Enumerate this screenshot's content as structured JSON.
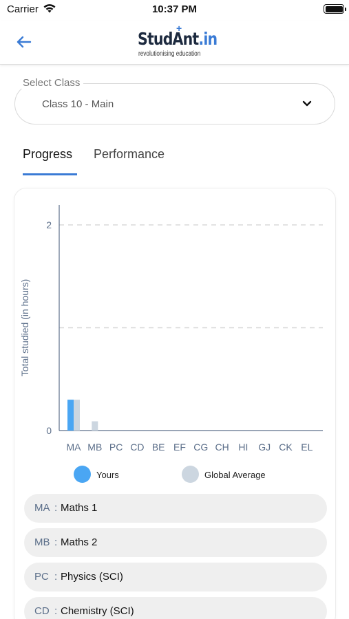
{
  "status_bar": {
    "carrier": "Carrier",
    "time": "10:37 PM",
    "wifi_icon": "wifi-icon",
    "battery_icon": "battery-icon"
  },
  "header": {
    "back_icon": "arrow-left-icon",
    "logo": {
      "main": "StudAnt",
      "tld": ".in",
      "star": "+",
      "tagline": "revolutionising education"
    }
  },
  "class_select": {
    "label": "Select Class",
    "value": "Class 10 - Main",
    "chevron_icon": "chevron-down-icon"
  },
  "tabs": [
    {
      "label": "Progress",
      "active": true
    },
    {
      "label": "Performance",
      "active": false
    }
  ],
  "colors": {
    "accent": "#3a7bd5",
    "yours": "#4aa6f3",
    "global_average": "#ccd6e0",
    "axis": "#5c6f8a",
    "pill_bg": "#efefef"
  },
  "chart_data": {
    "type": "bar",
    "title": "",
    "xlabel": "",
    "ylabel": "Total studied (in hours)",
    "ylim": [
      0,
      2
    ],
    "yticks": [
      0,
      2
    ],
    "grid": "dashed horizontal at 1 and 2",
    "legend_position": "bottom",
    "categories": [
      "MA",
      "MB",
      "PC",
      "CD",
      "BE",
      "EF",
      "CG",
      "CH",
      "HI",
      "GJ",
      "CK",
      "EL"
    ],
    "series": [
      {
        "name": "Yours",
        "color": "#4aa6f3",
        "values": [
          0.3,
          0,
          0,
          0,
          0,
          0,
          0,
          0,
          0,
          0,
          0,
          0
        ]
      },
      {
        "name": "Global Average",
        "color": "#ccd6e0",
        "values": [
          0.3,
          0.09,
          0,
          0,
          0,
          0,
          0,
          0,
          0,
          0,
          0,
          0
        ]
      }
    ]
  },
  "subjects": [
    {
      "code": "MA",
      "name": "Maths 1"
    },
    {
      "code": "MB",
      "name": "Maths 2"
    },
    {
      "code": "PC",
      "name": "Physics (SCI)"
    },
    {
      "code": "CD",
      "name": "Chemistry (SCI)"
    }
  ],
  "subject_separator": ":"
}
